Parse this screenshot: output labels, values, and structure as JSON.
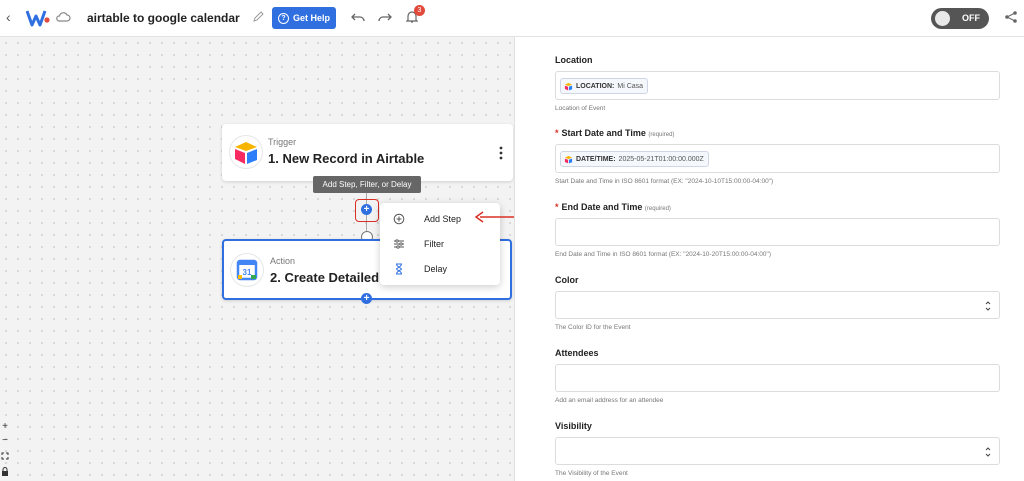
{
  "header": {
    "back_icon": "chevron-left-icon",
    "title": "airtable to google calendar",
    "help_label": "Get Help",
    "notification_count": "3",
    "toggle_label": "OFF"
  },
  "flow": {
    "tooltip": "Add Step, Filter, or Delay",
    "trigger": {
      "type": "Trigger",
      "name": "1. New Record in Airtable"
    },
    "action": {
      "type": "Action",
      "name": "2. Create Detailed Event"
    },
    "menu": [
      {
        "label": "Add Step",
        "icon": "plus-circle-icon"
      },
      {
        "label": "Filter",
        "icon": "filter-icon"
      },
      {
        "label": "Delay",
        "icon": "hourglass-icon"
      }
    ]
  },
  "zoom": {
    "plus": "+",
    "minus": "−"
  },
  "form": {
    "location": {
      "label": "Location",
      "chip_key": "LOCATION:",
      "chip_value": "Mi Casa",
      "help": "Location of Event"
    },
    "start": {
      "label": "Start Date and Time",
      "required_note": "(required)",
      "chip_key": "DATE/TIME:",
      "chip_value": "2025-05-21T01:00:00.000Z",
      "help": "Start Date and Time in ISO 8601 format (EX: \"2024-10-10T15:00:00-04:00\")"
    },
    "end": {
      "label": "End Date and Time",
      "required_note": "(required)",
      "help": "End Date and Time in ISO 8601 format (EX: \"2024-10-20T15:00:00-04:00\")"
    },
    "color": {
      "label": "Color",
      "help": "The Color ID for the Event"
    },
    "attendees": {
      "label": "Attendees",
      "help": "Add an email address for an attendee"
    },
    "visibility": {
      "label": "Visibility",
      "help": "The Visibility of the Event"
    }
  },
  "colors": {
    "accent": "#2f6fe0",
    "highlight": "#d93025",
    "badge": "#e24a3b"
  }
}
